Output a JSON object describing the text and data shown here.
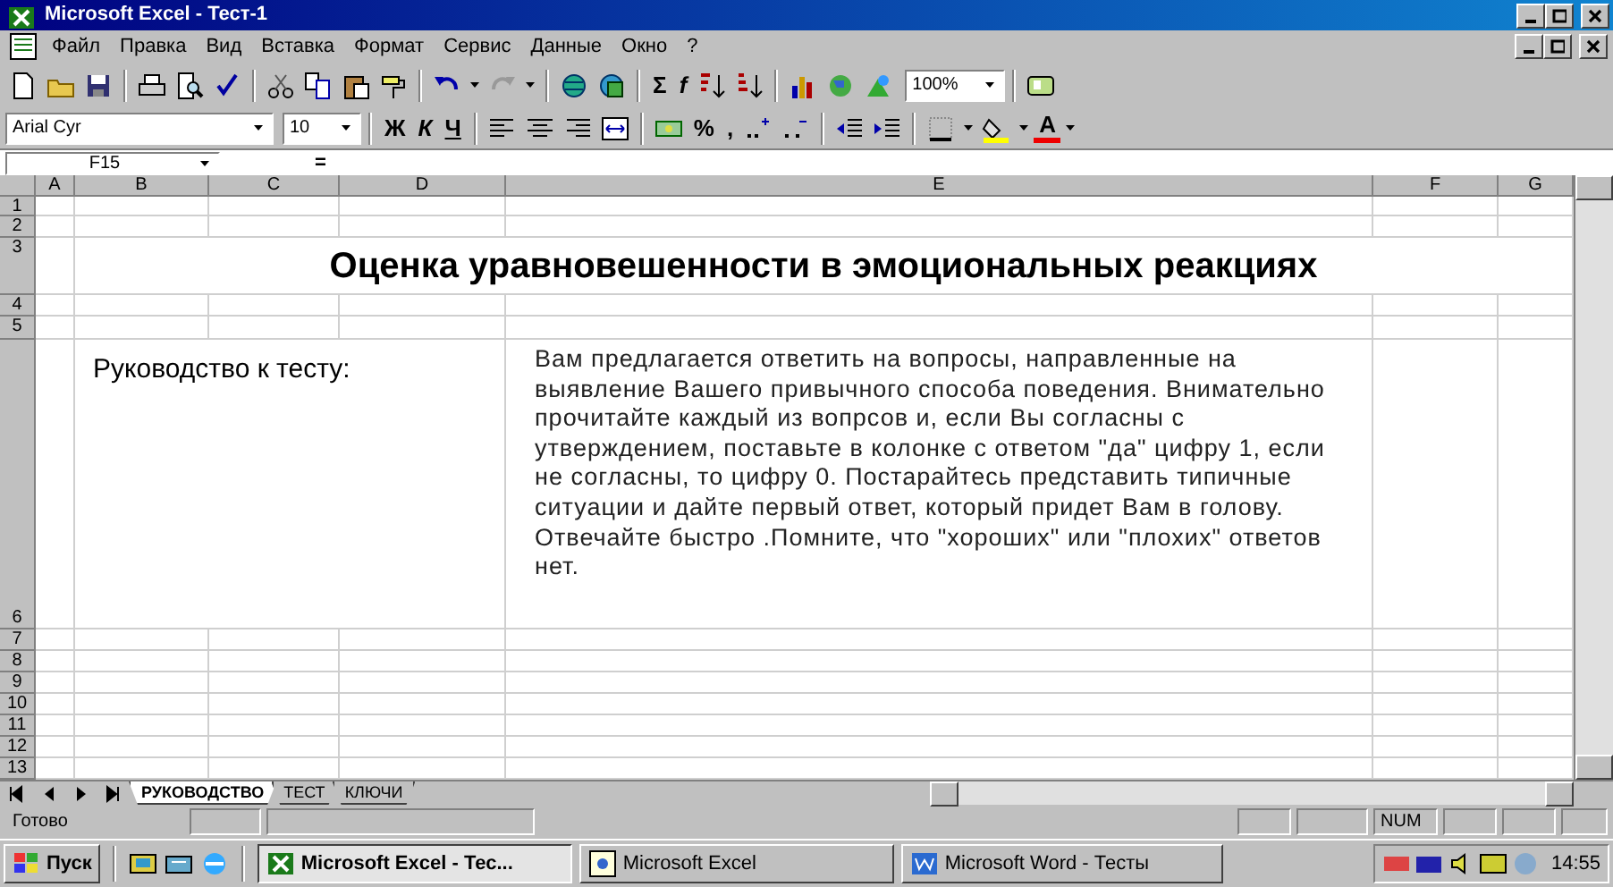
{
  "window": {
    "title": "Microsoft Excel - Тест-1"
  },
  "menu": [
    "Файл",
    "Правка",
    "Вид",
    "Вставка",
    "Формат",
    "Сервис",
    "Данные",
    "Окно",
    "?"
  ],
  "standard_toolbar": {
    "autosum": "Σ",
    "function": "f",
    "zoom": "100%"
  },
  "format_toolbar": {
    "font": "Arial Cyr",
    "size": "10",
    "bold": "Ж",
    "italic": "К",
    "underline": "Ч",
    "percent": "%",
    "comma": ",",
    "font_color": "A"
  },
  "formula_bar": {
    "name_box": "F15",
    "equals": "="
  },
  "sheet": {
    "columns": [
      "A",
      "B",
      "C",
      "D",
      "E",
      "F",
      "G"
    ],
    "rows": [
      "1",
      "2",
      "3",
      "4",
      "5",
      "6",
      "7",
      "8",
      "9",
      "10",
      "11",
      "12",
      "13"
    ],
    "title": "Оценка  уравновешенности в эмоциональных реакциях",
    "guide_label": "Руководство к тесту:",
    "guide_text": "Вам предлагается ответить на вопросы, направленные на выявление Вашего привычного способа поведения. Внимательно прочитайте каждый из вопрсов и, если Вы согласны с утверждением, поставьте в колонке с ответом \"да\" цифру 1, если не согласны, то цифру 0. Постарайтесь представить типичные ситуации и дайте первый ответ, который придет Вам в голову. Отвечайте быстро .Помните, что \"хороших\" или \"плохих\" ответов нет."
  },
  "sheet_tabs": [
    {
      "label": "РУКОВОДСТВО",
      "selected": true
    },
    {
      "label": "ТЕСТ",
      "selected": false
    },
    {
      "label": "КЛЮЧИ",
      "selected": false
    }
  ],
  "status_bar": {
    "status": "Готово",
    "indicator": "NUM"
  },
  "taskbar": {
    "start": "Пуск",
    "tasks": [
      {
        "label": "Microsoft Excel - Тес...",
        "selected": true
      },
      {
        "label": "Microsoft Excel",
        "selected": false
      },
      {
        "label": "Microsoft Word - Тесты",
        "selected": false
      }
    ],
    "clock": "14:55"
  }
}
